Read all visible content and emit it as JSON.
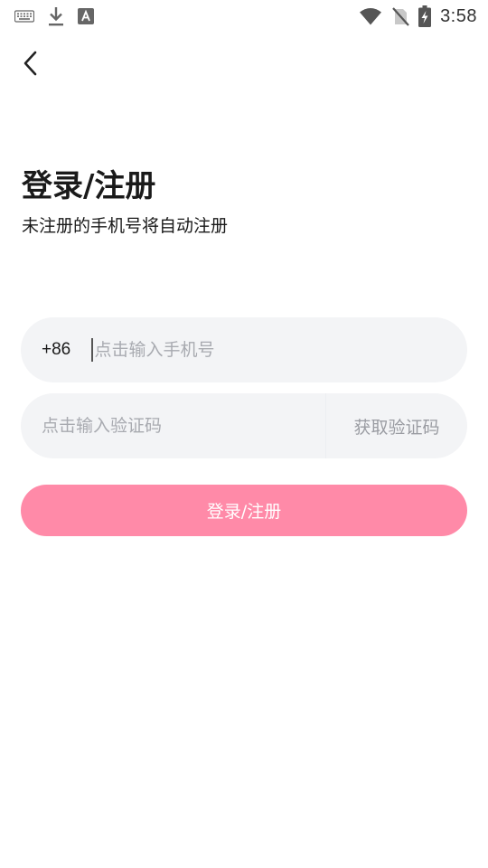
{
  "status_bar": {
    "time": "3:58",
    "left_icons": [
      "keyboard-icon",
      "download-icon",
      "font-a-icon"
    ],
    "right_icons": [
      "wifi-icon",
      "no-sim-icon",
      "battery-charging-icon"
    ]
  },
  "header": {
    "back_icon": "chevron-left-icon"
  },
  "main": {
    "title": "登录/注册",
    "subtitle": "未注册的手机号将自动注册",
    "phone": {
      "country_code": "+86",
      "placeholder": "点击输入手机号",
      "value": ""
    },
    "code": {
      "placeholder": "点击输入验证码",
      "value": "",
      "get_code_label": "获取验证码"
    },
    "submit_label": "登录/注册"
  },
  "colors": {
    "accent": "#ff8aa8",
    "field_bg": "#f3f4f6",
    "placeholder": "#a8aab0",
    "text": "#1a1a1a"
  }
}
